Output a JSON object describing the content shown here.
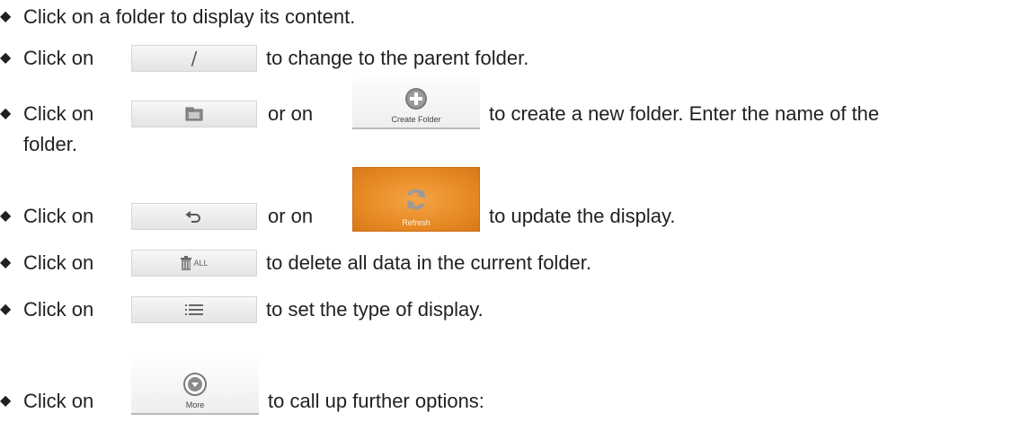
{
  "bullet_glyph": "◆",
  "lines": {
    "l1": "Click on a folder to display its content.",
    "l2_a": "Click on",
    "l2_b": "to change to the parent folder.",
    "l3_a": "Click on",
    "l3_b": "or on",
    "l3_c": "to create a new folder. Enter the name of the",
    "l3_d": "folder.",
    "l4_a": "Click on",
    "l4_b": "or on",
    "l4_c": "to update the display.",
    "l5_a": "Click on",
    "l5_b": "to delete all data in the current folder.",
    "l6_a": "Click on",
    "l6_b": "to set the type of display.",
    "l7_a": "Click on",
    "l7_b": "to call up further options:"
  },
  "buttons": {
    "parent_folder_glyph": "/",
    "create_folder_label": "Create Folder",
    "refresh_label": "Refresh",
    "delete_all_badge": "ALL",
    "more_label": "More"
  },
  "icon_names": {
    "new_folder": "folder-icon",
    "create_folder": "plus-circle-icon",
    "undo": "undo-arrow-icon",
    "refresh": "refresh-icon",
    "delete_all": "trash-icon",
    "list": "list-icon",
    "more": "chevron-down-circle-icon"
  },
  "colors": {
    "text": "#231f20",
    "orange": "#e78a24"
  }
}
